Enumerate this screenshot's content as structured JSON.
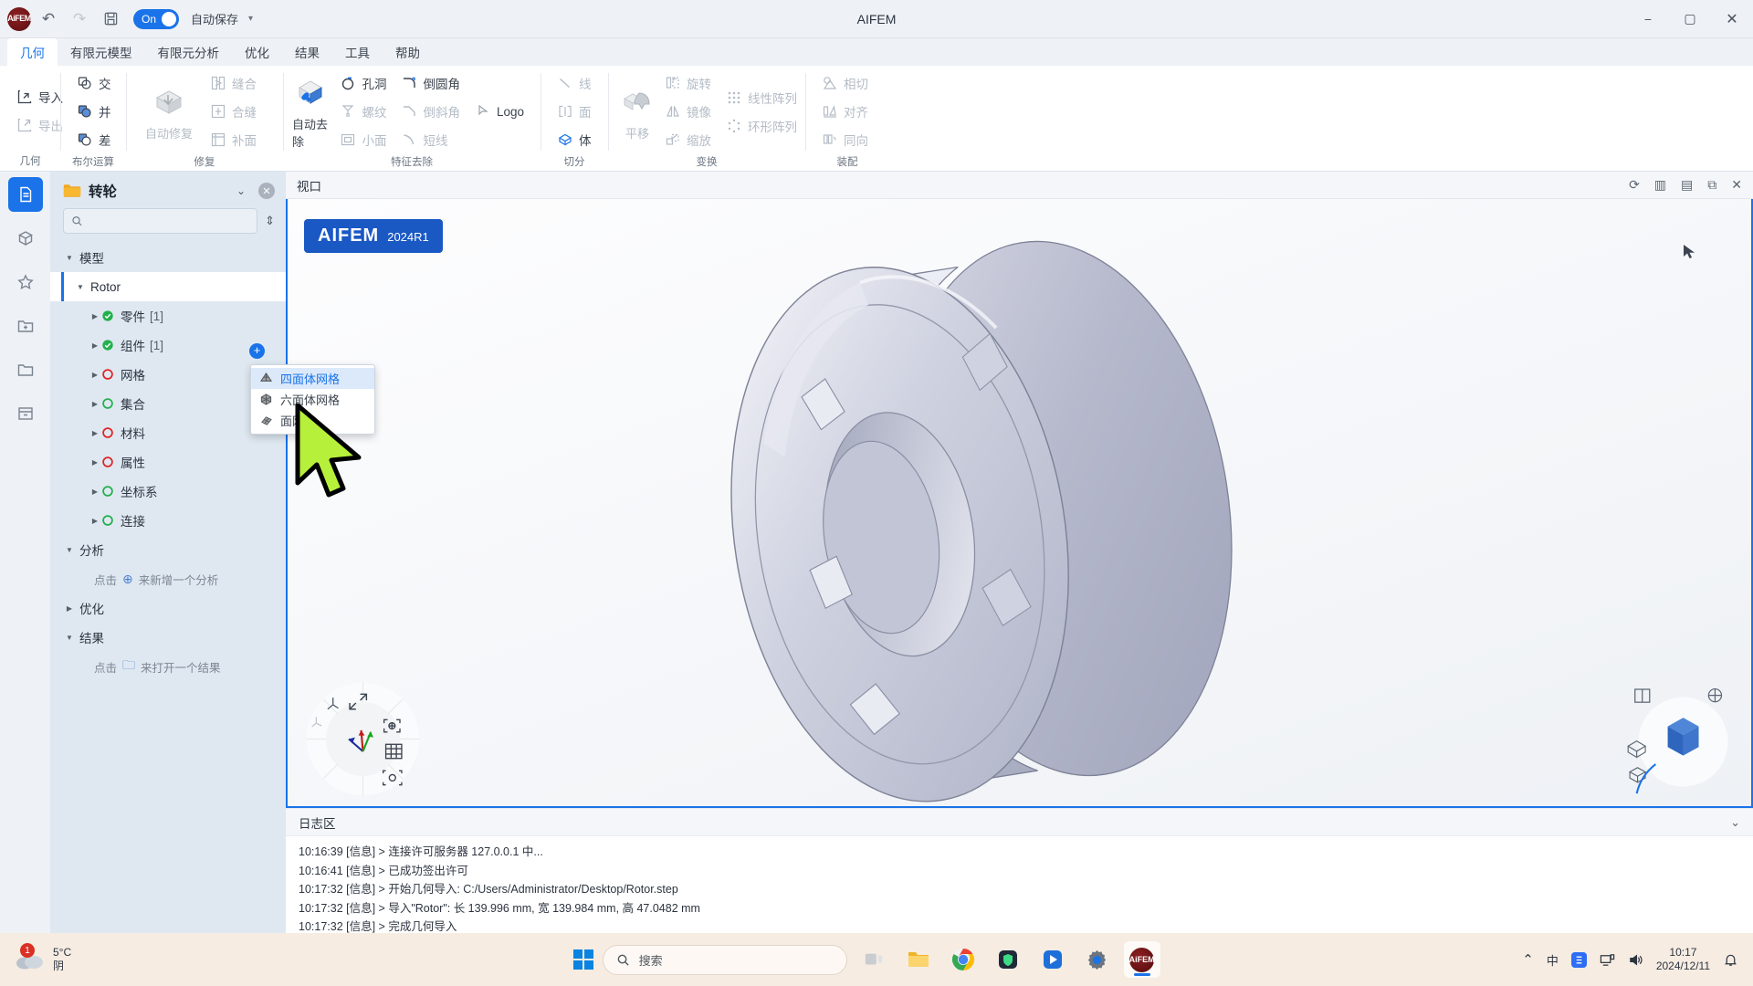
{
  "titlebar": {
    "app_initials": "AiFEM",
    "undo_icon": "undo-icon",
    "redo_icon": "redo-icon",
    "save_icon": "save-icon",
    "toggle_label": "On",
    "autosave_label": "自动保存",
    "title": "AIFEM",
    "minimize": "−",
    "maximize": "▢",
    "close": "✕"
  },
  "menu": {
    "tabs": [
      {
        "label": "几何",
        "active": true
      },
      {
        "label": "有限元模型",
        "active": false
      },
      {
        "label": "有限元分析",
        "active": false
      },
      {
        "label": "优化",
        "active": false
      },
      {
        "label": "结果",
        "active": false
      },
      {
        "label": "工具",
        "active": false
      },
      {
        "label": "帮助",
        "active": false
      }
    ]
  },
  "ribbon": {
    "groups": [
      {
        "name": "几何",
        "label": "几何",
        "items": [
          {
            "label": "导入",
            "dim": false
          },
          {
            "label": "导出",
            "dim": true
          }
        ]
      },
      {
        "name": "布尔运算",
        "label": "布尔运算",
        "items": [
          {
            "label": "交",
            "dim": false
          },
          {
            "label": "并",
            "dim": false
          },
          {
            "label": "差",
            "dim": false
          }
        ]
      },
      {
        "name": "修复",
        "label": "修复",
        "big": {
          "label": "自动修复",
          "dim": true
        },
        "items": [
          {
            "label": "缝合",
            "dim": true
          },
          {
            "label": "合缝",
            "dim": true
          },
          {
            "label": "补面",
            "dim": true
          }
        ]
      },
      {
        "name": "特征去除",
        "label": "特征去除",
        "big": {
          "label": "自动去除",
          "dim": false
        },
        "items": [
          {
            "label": "孔洞",
            "dim": false
          },
          {
            "label": "螺纹",
            "dim": true
          },
          {
            "label": "小面",
            "dim": true
          },
          {
            "label": "倒圆角",
            "dim": false
          },
          {
            "label": "倒斜角",
            "dim": true
          },
          {
            "label": "短线",
            "dim": true
          },
          {
            "label": "Logo",
            "dim": false
          }
        ]
      },
      {
        "name": "切分",
        "label": "切分",
        "items": [
          {
            "label": "线",
            "dim": true
          },
          {
            "label": "面",
            "dim": true
          },
          {
            "label": "体",
            "dim": false
          }
        ]
      },
      {
        "name": "变换",
        "label": "变换",
        "big": {
          "label": "平移",
          "dim": true
        },
        "items": [
          {
            "label": "旋转",
            "dim": true
          },
          {
            "label": "镜像",
            "dim": true
          },
          {
            "label": "缩放",
            "dim": true
          },
          {
            "label": "线性阵列",
            "dim": true
          },
          {
            "label": "环形阵列",
            "dim": true
          }
        ]
      },
      {
        "name": "装配",
        "label": "装配",
        "items": [
          {
            "label": "相切",
            "dim": true
          },
          {
            "label": "对齐",
            "dim": true
          },
          {
            "label": "同向",
            "dim": true
          }
        ]
      }
    ]
  },
  "rail": {
    "items": [
      {
        "name": "project-tree",
        "icon": "document-icon",
        "active": true
      },
      {
        "name": "library",
        "icon": "box-icon",
        "active": false
      },
      {
        "name": "favorites",
        "icon": "star-icon",
        "active": false
      },
      {
        "name": "new-folder",
        "icon": "folder-plus-icon",
        "active": false
      },
      {
        "name": "open-folder",
        "icon": "folder-icon",
        "active": false
      },
      {
        "name": "archive",
        "icon": "archive-icon",
        "active": false
      }
    ]
  },
  "tree": {
    "project_name": "转轮",
    "search_placeholder": "",
    "search_value": "",
    "sections": [
      {
        "label": "模型",
        "expanded": true
      },
      {
        "label": "分析",
        "expanded": true,
        "hint_prefix": "点击",
        "hint_suffix": "来新增一个分析"
      },
      {
        "label": "优化",
        "expanded": false
      },
      {
        "label": "结果",
        "expanded": true,
        "hint_prefix": "点击",
        "hint_suffix": "来打开一个结果"
      }
    ],
    "root": {
      "label": "Rotor",
      "selected": true
    },
    "nodes": [
      {
        "label": "零件",
        "count": "[1]",
        "status": "ok"
      },
      {
        "label": "组件",
        "count": "[1]",
        "status": "ok"
      },
      {
        "label": "网格",
        "count": "",
        "status": "empty-red"
      },
      {
        "label": "集合",
        "count": "",
        "status": "empty-green"
      },
      {
        "label": "材料",
        "count": "",
        "status": "empty-red"
      },
      {
        "label": "属性",
        "count": "",
        "status": "empty-red"
      },
      {
        "label": "坐标系",
        "count": "",
        "status": "empty-green"
      },
      {
        "label": "连接",
        "count": "",
        "status": "empty-green"
      }
    ],
    "add_button": "+"
  },
  "context_menu": {
    "items": [
      {
        "label": "四面体网格",
        "icon": "tet-mesh-icon",
        "highlighted": true
      },
      {
        "label": "六面体网格",
        "icon": "hex-mesh-icon",
        "highlighted": false
      },
      {
        "label": "面网格",
        "icon": "surface-mesh-icon",
        "highlighted": false
      }
    ]
  },
  "viewport": {
    "title": "视口",
    "tools": [
      "refresh-icon",
      "split-vertical-icon",
      "split-horizontal-icon",
      "popout-icon",
      "close-icon"
    ],
    "badge_main": "AIFEM",
    "badge_version": "2024R1"
  },
  "log": {
    "title": "日志区",
    "lines": [
      "10:16:39 [信息] > 连接许可服务器 127.0.0.1 中...",
      "10:16:41 [信息] > 已成功签出许可",
      "10:17:32 [信息] > 开始几何导入: C:/Users/Administrator/Desktop/Rotor.step",
      "10:17:32 [信息] > 导入\"Rotor\": 长 139.996 mm, 宽 139.984 mm, 高 47.0482 mm",
      "10:17:32 [信息] > 完成几何导入"
    ]
  },
  "taskbar": {
    "weather_badge": "1",
    "weather_temp": "5°C",
    "weather_cond": "阴",
    "search_placeholder": "搜索",
    "apps": [
      {
        "name": "task-view",
        "icon": "taskview-icon",
        "active": false
      },
      {
        "name": "file-explorer",
        "icon": "folder-icon",
        "active": false
      },
      {
        "name": "browser",
        "icon": "chrome-icon",
        "active": false
      },
      {
        "name": "shield-app",
        "icon": "shield-icon",
        "active": false
      },
      {
        "name": "media-app",
        "icon": "media-icon",
        "active": false
      },
      {
        "name": "settings",
        "icon": "gear-icon",
        "active": false
      },
      {
        "name": "aifem",
        "icon": "aifem-icon",
        "active": true
      }
    ],
    "tray_up": "⌃",
    "ime": "中",
    "tray_icons": [
      "sogou-icon",
      "network-icon",
      "volume-icon"
    ],
    "clock_time": "10:17",
    "clock_date": "2024/12/11",
    "notify_icon": "bell-icon"
  },
  "colors": {
    "accent": "#1a73e8",
    "panel": "#dfe8f1",
    "chrome": "#eef1f5",
    "taskbar": "#f6ece2",
    "ok_green": "#22b14c",
    "empty_red": "#e02424"
  }
}
